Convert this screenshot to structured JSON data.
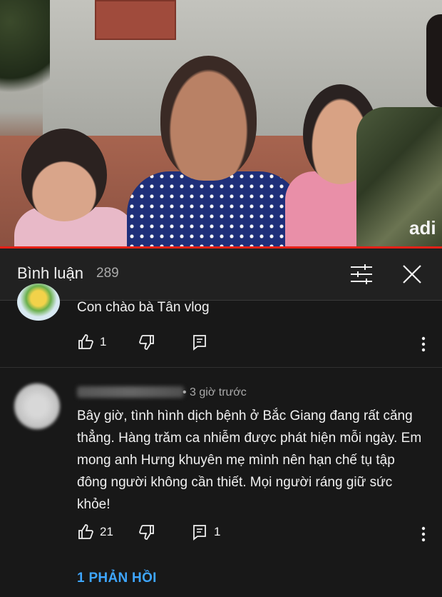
{
  "header": {
    "title": "Bình luận",
    "count": "289"
  },
  "comments": [
    {
      "text": "Con chào bà Tân vlog",
      "likes": "1",
      "replies": ""
    },
    {
      "time": "• 3 giờ trước",
      "text": "Bây giờ, tình hình dịch bệnh ở Bắc Giang đang rất căng thẳng. Hàng trăm ca nhiễm được phát hiện mỗi ngày. Em mong anh Hưng khuyên mẹ mình nên hạn chế tụ tập đông người không cần thiết. Mọi người ráng giữ sức khỏe!",
      "likes": "21",
      "replies": "1",
      "reply_link": "1 PHẢN HỒI"
    }
  ],
  "video": {
    "shirt_text": "adi"
  },
  "colors": {
    "background": "#181818",
    "header_bg": "#212121",
    "progress": "#e62117",
    "link": "#3ea6ff"
  },
  "icons": [
    "filter-icon",
    "close-icon",
    "like-icon",
    "dislike-icon",
    "reply-icon",
    "more-icon"
  ]
}
